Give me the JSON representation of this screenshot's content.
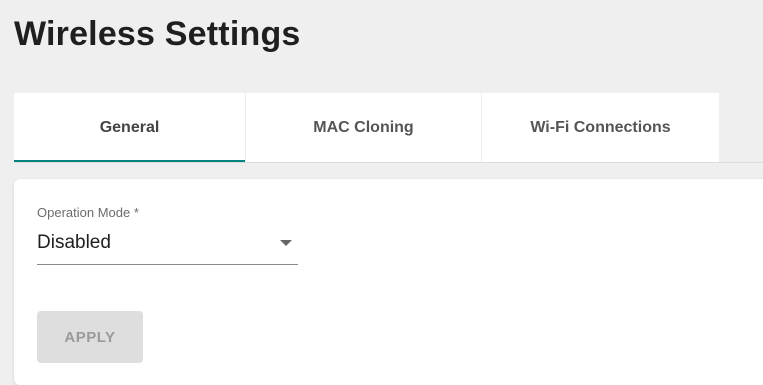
{
  "page": {
    "title": "Wireless Settings"
  },
  "tabs": [
    {
      "label": "General",
      "active": true
    },
    {
      "label": "MAC Cloning",
      "active": false
    },
    {
      "label": "Wi-Fi Connections",
      "active": false
    }
  ],
  "form": {
    "operation_mode": {
      "label": "Operation Mode *",
      "value": "Disabled",
      "icon": "chevron-down-icon"
    },
    "apply_button": {
      "label": "APPLY",
      "disabled": true
    }
  },
  "colors": {
    "accent": "#00827f",
    "background": "#efefef",
    "card": "#ffffff",
    "button_disabled_bg": "#dedede",
    "button_disabled_text": "#9a9a9a"
  }
}
